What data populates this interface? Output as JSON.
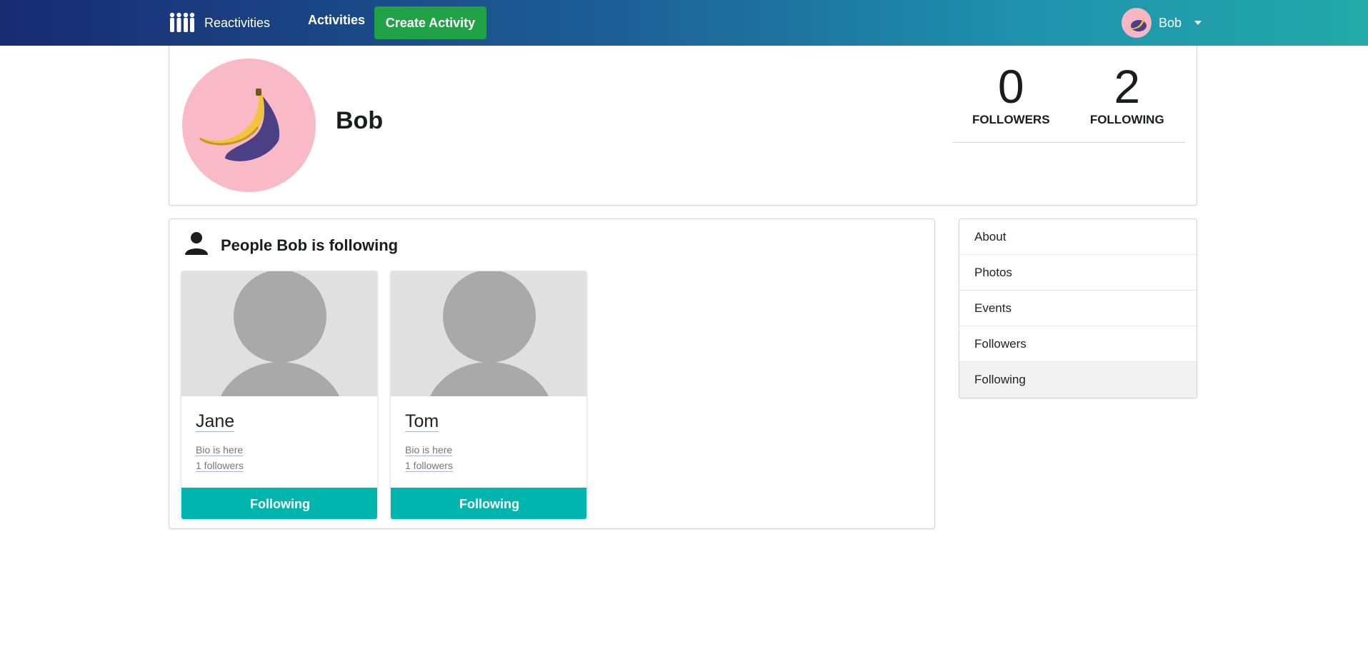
{
  "nav": {
    "brand": "Reactivities",
    "activities": "Activities",
    "create_activity": "Create Activity",
    "username": "Bob",
    "brand_icon": "people-group-icon",
    "caret_icon": "caret-down-icon"
  },
  "profile": {
    "display_name": "Bob",
    "avatar": "banana-image",
    "stats": [
      {
        "value": "0",
        "label": "FOLLOWERS"
      },
      {
        "value": "2",
        "label": "FOLLOWING"
      }
    ]
  },
  "following_panel": {
    "title": "People Bob is following",
    "icon": "user-icon",
    "people": [
      {
        "name": "Jane",
        "bio": "Bio is here",
        "followers": "1 followers",
        "button": "Following"
      },
      {
        "name": "Tom",
        "bio": "Bio is here",
        "followers": "1 followers",
        "button": "Following"
      }
    ]
  },
  "side_menu": {
    "items": [
      "About",
      "Photos",
      "Events",
      "Followers",
      "Following"
    ],
    "active": "Following"
  },
  "colors": {
    "nav_gradient_start": "#182b72",
    "nav_gradient_end": "#22aaa8",
    "create_button": "#21a246",
    "follow_button": "#00b5ad",
    "avatar_background": "#f9b9c6"
  }
}
